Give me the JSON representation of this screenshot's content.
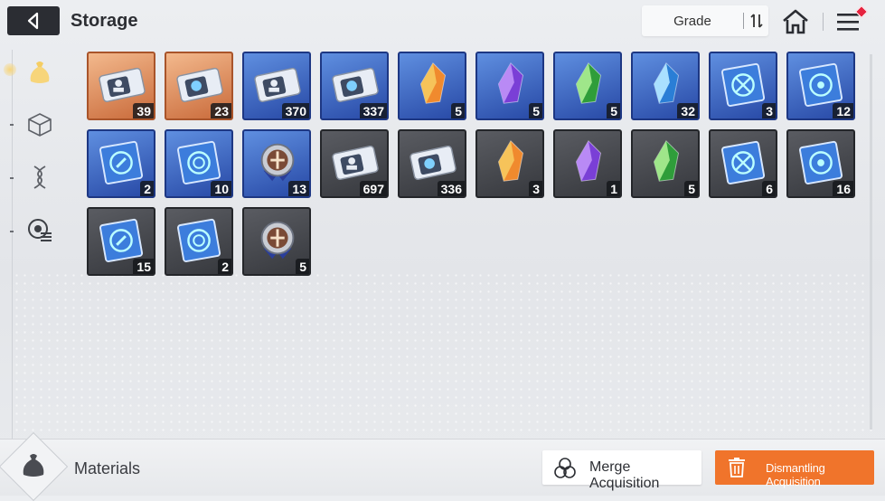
{
  "header": {
    "title": "Storage",
    "back_icon": "back-arrow-icon"
  },
  "sort": {
    "label": "Grade",
    "icon": "sort-toggle-icon"
  },
  "topbar": {
    "home_icon": "home-icon",
    "menu_icon": "menu-icon",
    "notification_color": "#e6233f"
  },
  "sidebar": {
    "items": [
      {
        "name": "materials",
        "icon": "bag-icon",
        "active": true
      },
      {
        "name": "cube",
        "icon": "cube-icon",
        "active": false
      },
      {
        "name": "dna",
        "icon": "dna-icon",
        "active": false
      },
      {
        "name": "chip",
        "icon": "chip-icon",
        "active": false
      }
    ]
  },
  "items": [
    {
      "icon": "ticket-portrait-icon",
      "grade": "orange",
      "qty": "39"
    },
    {
      "icon": "ticket-compass-icon",
      "grade": "orange",
      "qty": "23"
    },
    {
      "icon": "ticket-portrait-icon",
      "grade": "blue",
      "qty": "370"
    },
    {
      "icon": "ticket-compass-icon",
      "grade": "blue",
      "qty": "337"
    },
    {
      "icon": "crystal-orange-icon",
      "grade": "blue",
      "qty": "5"
    },
    {
      "icon": "crystal-purple-icon",
      "grade": "blue",
      "qty": "5"
    },
    {
      "icon": "crystal-green-icon",
      "grade": "blue",
      "qty": "5"
    },
    {
      "icon": "crystal-blue-icon",
      "grade": "blue",
      "qty": "32"
    },
    {
      "icon": "book-sword-icon",
      "grade": "blue",
      "qty": "3"
    },
    {
      "icon": "book-eye-icon",
      "grade": "blue",
      "qty": "12"
    },
    {
      "icon": "book-bolt-icon",
      "grade": "blue",
      "qty": "2"
    },
    {
      "icon": "book-globe-icon",
      "grade": "blue",
      "qty": "10"
    },
    {
      "icon": "medal-icon",
      "grade": "blue",
      "qty": "13"
    },
    {
      "icon": "ticket-portrait-icon",
      "grade": "gray",
      "qty": "697"
    },
    {
      "icon": "ticket-compass-icon",
      "grade": "gray",
      "qty": "336"
    },
    {
      "icon": "crystal-orange-icon",
      "grade": "gray",
      "qty": "3"
    },
    {
      "icon": "crystal-purple-icon",
      "grade": "gray",
      "qty": "1"
    },
    {
      "icon": "crystal-green-icon",
      "grade": "gray",
      "qty": "5"
    },
    {
      "icon": "book-sword-icon",
      "grade": "gray",
      "qty": "6"
    },
    {
      "icon": "book-eye-icon",
      "grade": "gray",
      "qty": "16"
    },
    {
      "icon": "book-bolt-icon",
      "grade": "gray",
      "qty": "15"
    },
    {
      "icon": "book-globe-icon",
      "grade": "gray",
      "qty": "2"
    },
    {
      "icon": "medal-icon",
      "grade": "gray",
      "qty": "5"
    }
  ],
  "footer": {
    "category_label": "Materials",
    "merge_label": "Merge Acquisition",
    "dismantle_label": "Dismantling Acquisition",
    "dismantle_color": "#f0742b"
  }
}
